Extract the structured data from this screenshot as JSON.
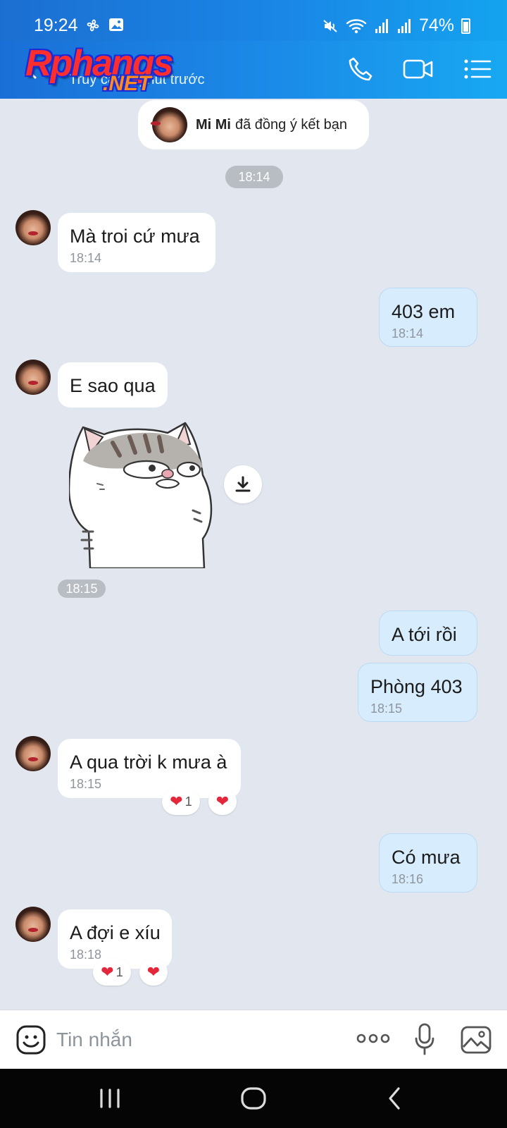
{
  "status_bar": {
    "time": "19:24",
    "battery": "74%"
  },
  "header": {
    "logo_main": "Rphangs",
    "logo_sub": ".NET",
    "subtitle": "Truy cập 1 phút trước"
  },
  "system_card": {
    "name": "Mi Mi",
    "text": "đã đồng ý kết bạn"
  },
  "time_dividers": {
    "first": "18:14"
  },
  "messages": [
    {
      "text": "Mà troi cứ mưa",
      "time": "18:14"
    },
    {
      "text": "403 em",
      "time": "18:14"
    },
    {
      "text": "E sao qua"
    },
    {
      "sticker_time": "18:15"
    },
    {
      "text": "A tới rồi"
    },
    {
      "text": "Phòng 403",
      "time": "18:15"
    },
    {
      "text": "A qua trời k mưa à",
      "time": "18:15",
      "reaction_count": "1"
    },
    {
      "text": "Có mưa",
      "time": "18:16"
    },
    {
      "text": "A đợi e xíu",
      "time": "18:18",
      "reaction_count": "1"
    }
  ],
  "composer": {
    "placeholder": "Tin nhắn"
  },
  "icons": [
    "back-arrow-icon",
    "phone-icon",
    "video-call-icon",
    "menu-list-icon",
    "download-icon",
    "emoji-icon",
    "more-icon",
    "mic-icon",
    "gallery-icon",
    "heart-icon"
  ],
  "colors": {
    "header_blue": "#1b8be8",
    "outgoing_bubble": "#d7ecfc",
    "chat_bg": "#e2e6ee",
    "heart": "#e5273b"
  }
}
